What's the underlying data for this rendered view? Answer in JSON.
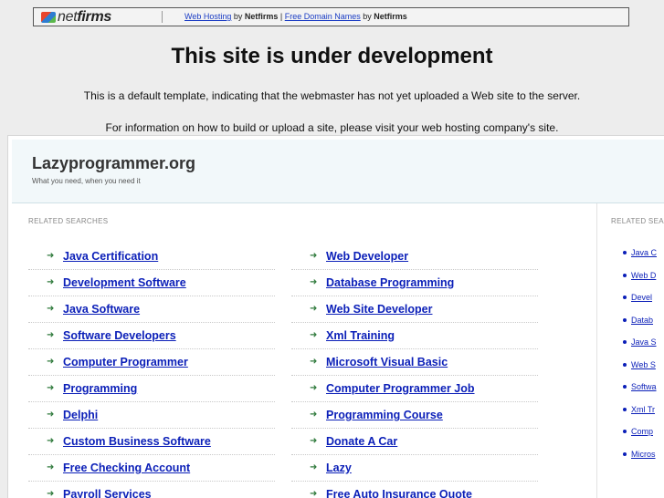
{
  "topbar": {
    "logo_net": "net",
    "logo_firms": "firms",
    "link1": "Web Hosting",
    "by1": " by ",
    "brand1": "Netfirms",
    "divider": " | ",
    "link2": "Free Domain Names",
    "by2": " by ",
    "brand2": "Netfirms"
  },
  "notice": {
    "title": "This site is under development",
    "line1": "This is a default template, indicating that the webmaster has not yet uploaded a Web site to the server.",
    "line2": "For information on how to build or upload a site, please visit your web hosting company's site."
  },
  "parked": {
    "site_name": "Lazyprogrammer.org",
    "tagline": "What you need, when you need it",
    "related_label": "RELATED SEARCHES",
    "side_label": "RELATED SEARCHES",
    "left_links": [
      "Java Certification",
      "Development Software",
      "Java Software",
      "Software Developers",
      "Computer Programmer",
      "Programming",
      "Delphi",
      "Custom Business Software",
      "Free Checking Account",
      "Payroll Services"
    ],
    "right_links": [
      "Web Developer",
      "Database Programming",
      "Web Site Developer",
      "Xml Training",
      "Microsoft Visual Basic",
      "Computer Programmer Job",
      "Programming Course",
      "Donate A Car",
      "Lazy",
      "Free Auto Insurance Quote"
    ],
    "side_links": [
      "Java C",
      "Web D",
      "Devel",
      "Datab",
      "Java S",
      "Web S",
      "Softwa",
      "Xml Tr",
      "Comp",
      "Micros"
    ]
  },
  "colors": {
    "link": "#0b1fb8",
    "arrow": "#2f7a3c",
    "header_bg": "#f2f8fa",
    "page_bg": "#ededed"
  },
  "icons": {
    "row_arrow": "arrow-right-icon",
    "side_bullet": "bullet-icon",
    "logo": "netfirms-logo-icon"
  }
}
